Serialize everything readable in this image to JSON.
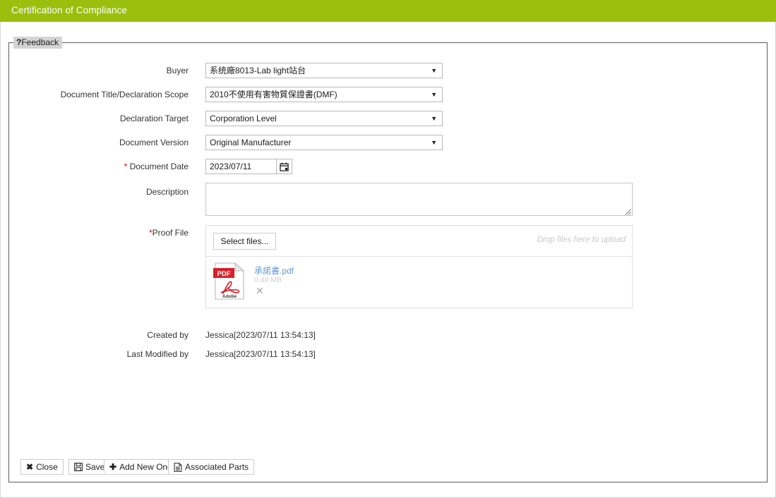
{
  "window": {
    "title": "Certification of Compliance",
    "header_color": "#9ABF0D"
  },
  "feedback_tab": {
    "icon": "question-mark-icon",
    "icon_glyph": "?",
    "label": "Feedback"
  },
  "form": {
    "fields": [
      {
        "label": "Buyer",
        "required": false,
        "type": "select",
        "value": "系统廠8013-Lab light站台",
        "caret": "▼"
      },
      {
        "label": "Document Title/Declaration Scope",
        "required": false,
        "type": "select",
        "value": "2010不使用有害物質保證書(DMF)",
        "caret": "▼"
      },
      {
        "label": "Declaration Target",
        "required": false,
        "type": "select",
        "value": "Corporation Level",
        "caret": "▼"
      },
      {
        "label": "Document Version",
        "required": false,
        "type": "select",
        "value": "Original Manufacturer",
        "caret": "▼"
      }
    ],
    "document_date": {
      "label": "Document Date",
      "required_marker": "*",
      "value": "2023/07/11",
      "placeholder": "",
      "calendar_icon": "calendar-icon"
    },
    "description": {
      "label": "Description",
      "value": "",
      "placeholder": ""
    },
    "proof_file": {
      "label": "Proof File",
      "required_marker": "*",
      "select_files_label": "Select files...",
      "drop_hint": "Drop files here to upload",
      "files": [
        {
          "icon": "pdf-file-icon",
          "icon_label": "PDF",
          "icon_brand": "Adobe",
          "name": "承諾書.pdf",
          "size": "0.48 MB",
          "remove_glyph": "✕"
        }
      ]
    },
    "created_by": {
      "label": "Created by",
      "value": "Jessica[2023/07/11 13:54:13]"
    },
    "last_modified_by": {
      "label": "Last Modified by",
      "value": "Jessica[2023/07/11 13:54:13]"
    }
  },
  "buttons": [
    {
      "name": "close",
      "icon": "close-x-icon",
      "glyph": "✖",
      "label": "Close"
    },
    {
      "name": "save",
      "icon": "save-floppy-icon",
      "glyph": "",
      "label": "Save"
    },
    {
      "name": "add-new-one",
      "icon": "plus-icon",
      "glyph": "✚",
      "label": "Add New One"
    },
    {
      "name": "associated-parts",
      "icon": "document-lines-icon",
      "glyph": "",
      "label": "Associated Parts"
    }
  ]
}
